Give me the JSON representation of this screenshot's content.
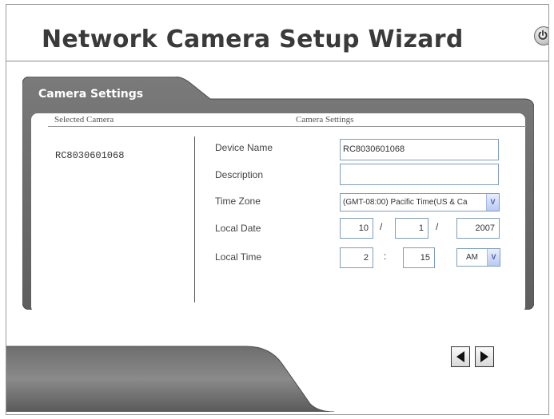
{
  "window": {
    "title": "Network Camera Setup Wizard",
    "power_icon": "power-icon"
  },
  "panel": {
    "tab_label": "Camera Settings",
    "col_selected": "Selected Camera",
    "col_settings": "Camera Settings"
  },
  "cameras": [
    "RC8030601068"
  ],
  "form": {
    "device_name_label": "Device Name",
    "device_name_value": "RC8030601068",
    "description_label": "Description",
    "description_value": "",
    "time_zone_label": "Time Zone",
    "time_zone_value": "(GMT-08:00) Pacific Time(US & Ca",
    "local_date_label": "Local Date",
    "date_month": "10",
    "date_day": "1",
    "date_year": "2007",
    "date_sep": "/",
    "local_time_label": "Local Time",
    "time_hour": "2",
    "time_minute": "15",
    "time_sep": ":",
    "time_ampm": "AM"
  },
  "nav": {
    "back_icon": "left-arrow-icon",
    "next_icon": "right-arrow-icon"
  },
  "colors": {
    "panel_dark": "#6b6b6b",
    "panel_tab": "#5a5a5a",
    "select_arrow": "#4a5fa8"
  }
}
